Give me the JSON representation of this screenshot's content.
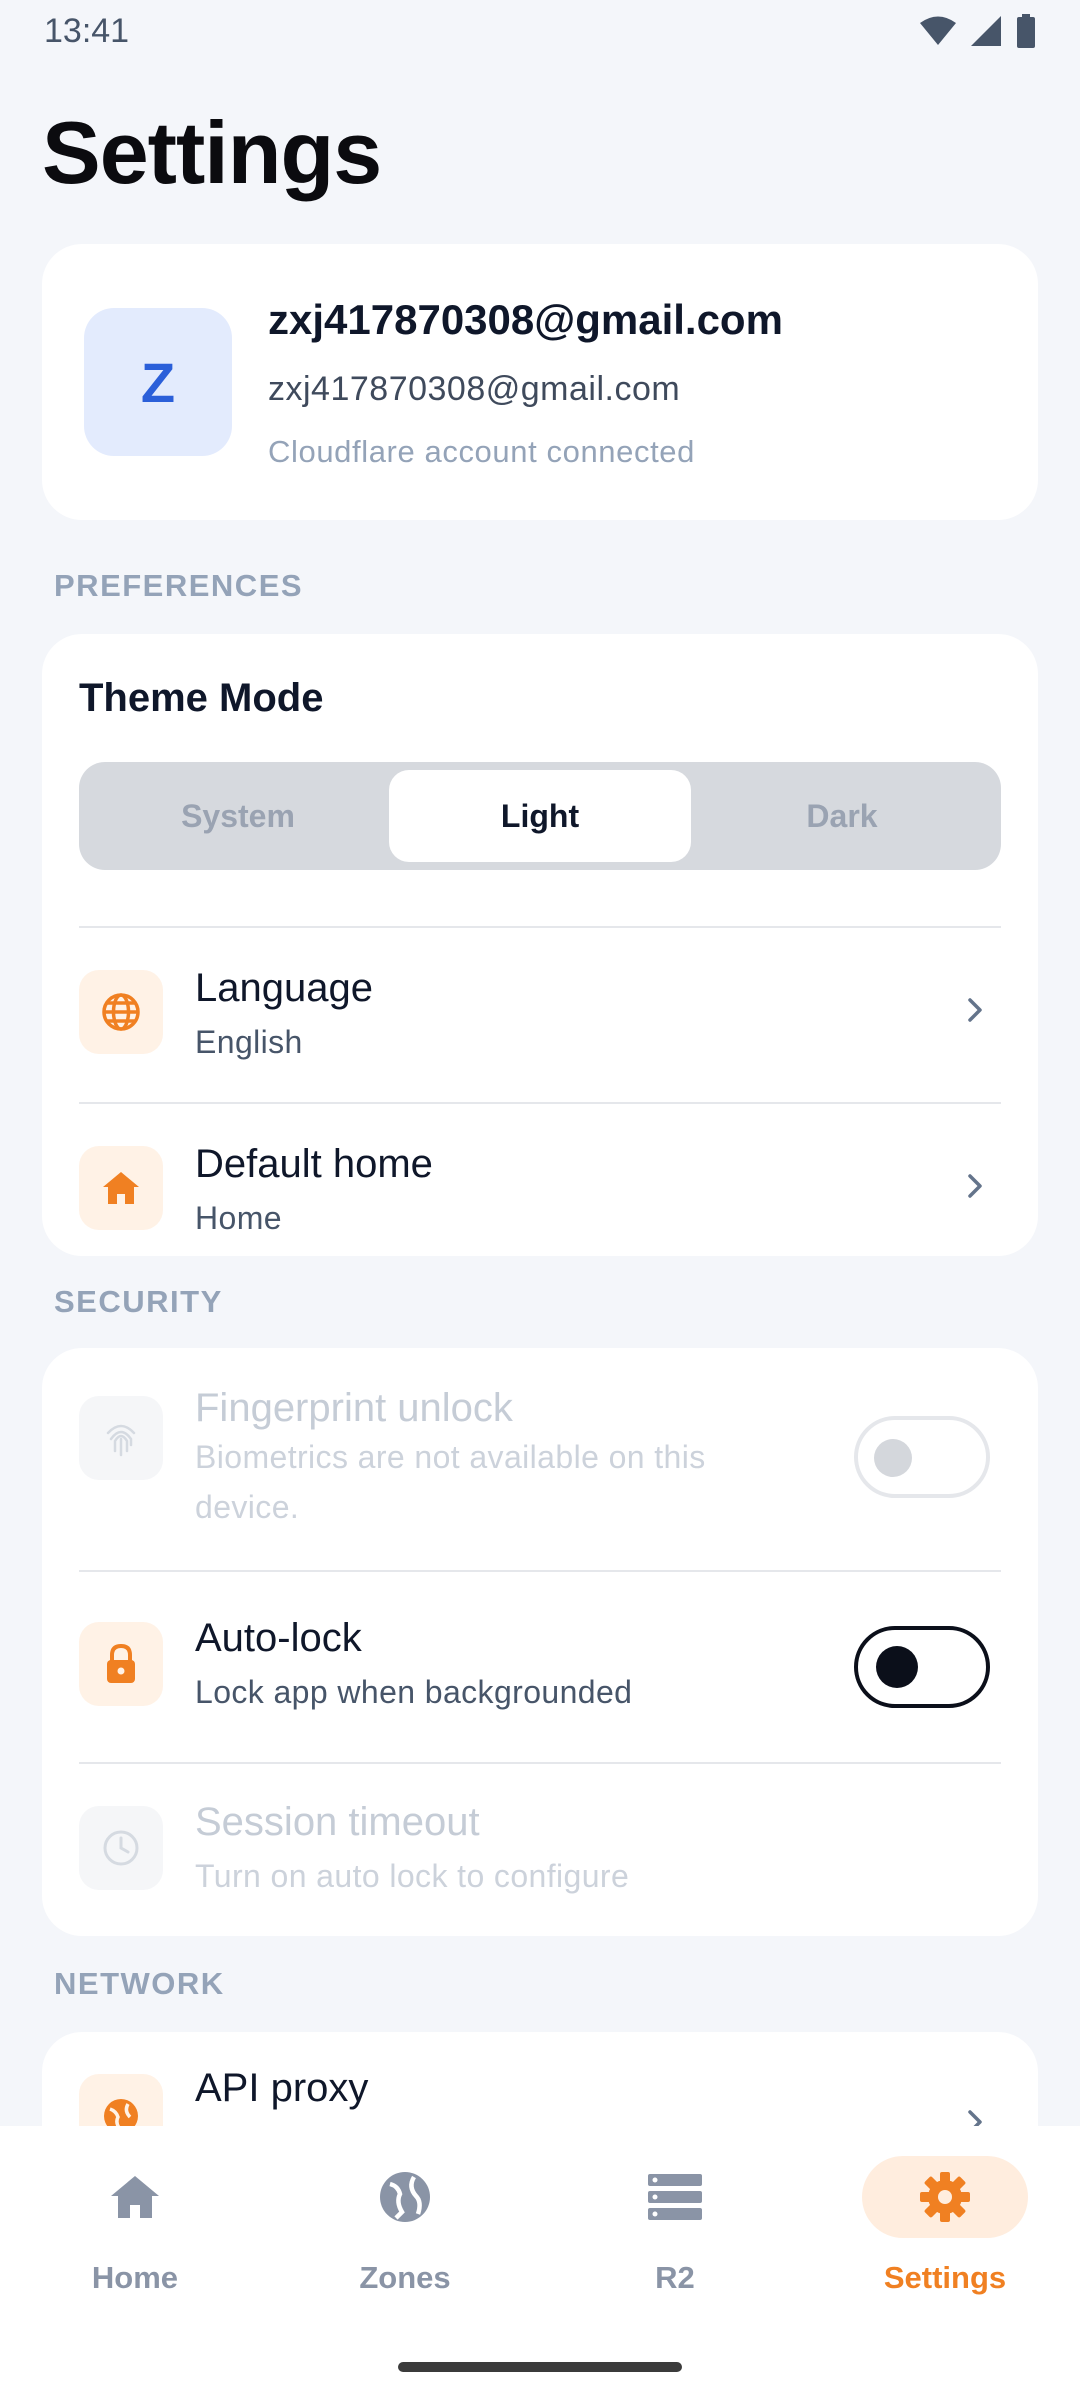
{
  "status_bar": {
    "time": "13:41"
  },
  "page": {
    "title": "Settings"
  },
  "account": {
    "initial": "Z",
    "name": "zxj417870308@gmail.com",
    "email": "zxj417870308@gmail.com",
    "status": "Cloudflare account connected"
  },
  "preferences": {
    "section_label": "PREFERENCES",
    "theme_title": "Theme Mode",
    "theme_options": [
      "System",
      "Light",
      "Dark"
    ],
    "theme_selected": "Light",
    "language": {
      "title": "Language",
      "value": "English"
    },
    "default_home": {
      "title": "Default home",
      "value": "Home"
    }
  },
  "security": {
    "section_label": "SECURITY",
    "fingerprint": {
      "title": "Fingerprint unlock",
      "subtitle": "Biometrics are not available on this device.",
      "enabled": false,
      "available": false
    },
    "auto_lock": {
      "title": "Auto-lock",
      "subtitle": "Lock app when backgrounded",
      "enabled": false
    },
    "session_timeout": {
      "title": "Session timeout",
      "subtitle": "Turn on auto lock to configure"
    }
  },
  "network": {
    "section_label": "NETWORK",
    "api_proxy": {
      "title": "API proxy"
    }
  },
  "nav": {
    "items": [
      {
        "label": "Home",
        "icon": "home-icon"
      },
      {
        "label": "Zones",
        "icon": "globe-icon"
      },
      {
        "label": "R2",
        "icon": "storage-icon"
      },
      {
        "label": "Settings",
        "icon": "gear-icon"
      }
    ],
    "active": "Settings"
  },
  "colors": {
    "accent": "#f08022",
    "accent_soft": "#fff2e6",
    "avatar_bg": "#e3ebfd",
    "avatar_text": "#2b5fd9"
  }
}
